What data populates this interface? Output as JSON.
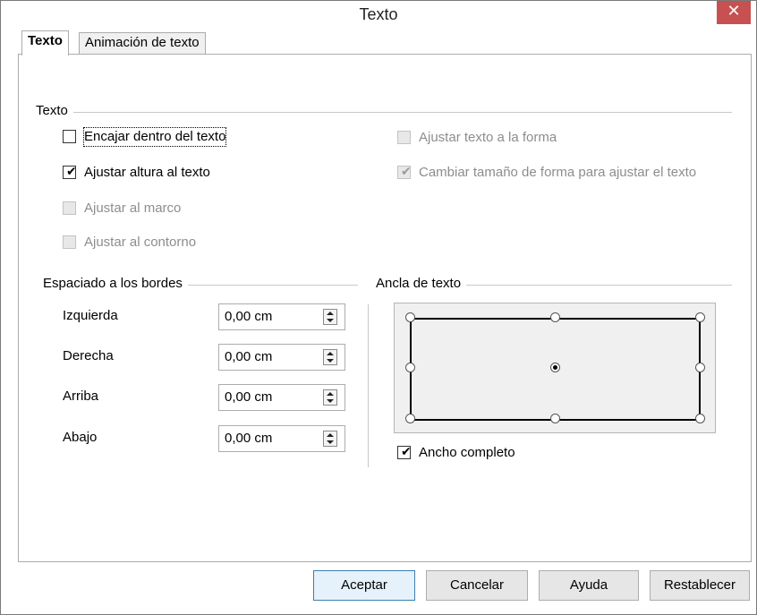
{
  "window": {
    "title": "Texto",
    "close_icon": "close-icon",
    "close_glyph": "✕"
  },
  "tabs": [
    {
      "label": "Texto",
      "active": true
    },
    {
      "label": "Animación de texto",
      "active": false
    }
  ],
  "text_group": {
    "label": "Texto",
    "checkboxes_left": [
      {
        "label": "Encajar dentro del texto",
        "checked": false,
        "enabled": true
      },
      {
        "label": "Ajustar altura al texto",
        "checked": true,
        "enabled": true
      },
      {
        "label": "Ajustar al marco",
        "checked": false,
        "enabled": false
      },
      {
        "label": "Ajustar al contorno",
        "checked": false,
        "enabled": false
      }
    ],
    "checkboxes_right": [
      {
        "label": "Ajustar texto a la forma",
        "checked": false,
        "enabled": false
      },
      {
        "label": "Cambiar tamaño de forma para ajustar el texto",
        "checked": true,
        "enabled": false
      }
    ]
  },
  "spacing_group": {
    "label": "Espaciado a los bordes",
    "fields": [
      {
        "label": "Izquierda",
        "value": "0,00 cm"
      },
      {
        "label": "Derecha",
        "value": "0,00 cm"
      },
      {
        "label": "Arriba",
        "value": "0,00 cm"
      },
      {
        "label": "Abajo",
        "value": "0,00 cm"
      }
    ]
  },
  "anchor_group": {
    "label": "Ancla de texto",
    "selected_position": "center",
    "full_width": {
      "label": "Ancho completo",
      "checked": true
    }
  },
  "buttons": {
    "ok": "Aceptar",
    "cancel": "Cancelar",
    "help": "Ayuda",
    "reset": "Restablecer"
  },
  "check_glyph": "✔"
}
